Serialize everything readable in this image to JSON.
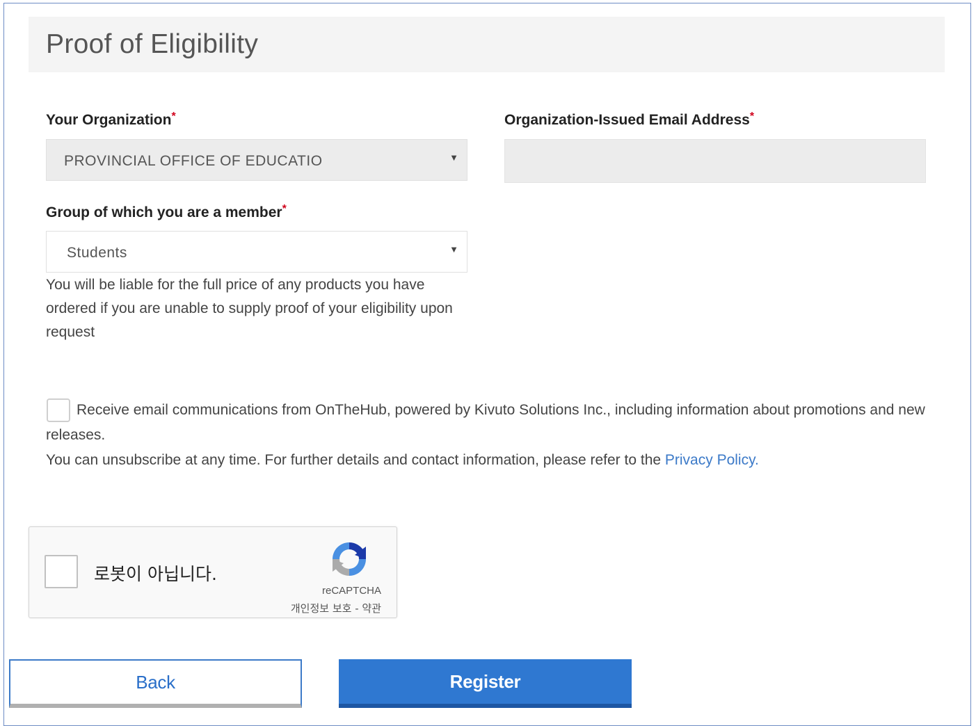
{
  "section": {
    "title": "Proof of Eligibility"
  },
  "organization": {
    "label": "Your Organization",
    "required_mark": "*",
    "selected_value": "PROVINCIAL OFFICE OF EDUCATIO"
  },
  "email": {
    "label": "Organization-Issued Email Address",
    "required_mark": "*",
    "value": ""
  },
  "group": {
    "label": "Group of which you are a member",
    "required_mark": "*",
    "selected_value": "Students"
  },
  "liability_note": "You will be liable for the full price of any products you have ordered if you are unable to supply proof of your eligibility upon request",
  "consent": {
    "checked": false,
    "text_line1": "Receive email communications from OnTheHub, powered by Kivuto Solutions Inc., including information about promotions and new releases.",
    "text_line2_prefix": "You can unsubscribe at any time. For further details and contact information, please refer to the ",
    "privacy_link": "Privacy Policy",
    "text_line2_suffix": "."
  },
  "captcha": {
    "label": "로봇이 아닙니다.",
    "brand": "reCAPTCHA",
    "terms": "개인정보 보호 - 약관"
  },
  "buttons": {
    "back": "Back",
    "register": "Register"
  },
  "colors": {
    "accent": "#2f78d1",
    "link": "#3c7ac8",
    "required": "#d0021b"
  }
}
